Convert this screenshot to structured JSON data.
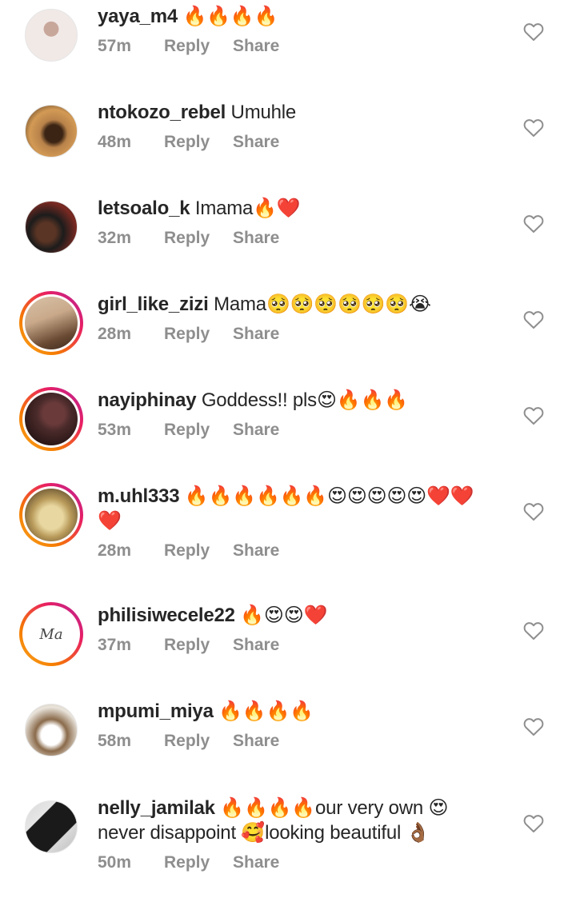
{
  "comments": [
    {
      "username": "yaya_m4",
      "text": " 🔥🔥🔥🔥",
      "time": "57m",
      "reply": "Reply",
      "share": "Share",
      "story_ring": false,
      "avatar_colors": [
        "#f1e9e6",
        "#c8a79b"
      ]
    },
    {
      "username": "ntokozo_rebel",
      "text": " Umuhle",
      "time": "48m",
      "reply": "Reply",
      "share": "Share",
      "story_ring": false,
      "avatar_colors": [
        "#d39a55",
        "#3b2414"
      ]
    },
    {
      "username": "letsoalo_k",
      "text": " Imama🔥❤️",
      "time": "32m",
      "reply": "Reply",
      "share": "Share",
      "story_ring": false,
      "avatar_colors": [
        "#7a2a22",
        "#1c1c1c"
      ]
    },
    {
      "username": "girl_like_zizi",
      "text": " Mama🥺🥺🥺🥺🥺🥺😭",
      "time": "28m",
      "reply": "Reply",
      "share": "Share",
      "story_ring": true,
      "avatar_colors": [
        "#c9a98a",
        "#6a4a33"
      ]
    },
    {
      "username": "nayiphinay",
      "text": " Goddess!! pls😍🔥🔥🔥",
      "time": "53m",
      "reply": "Reply",
      "share": "Share",
      "story_ring": true,
      "avatar_colors": [
        "#4a2a2a",
        "#140808"
      ]
    },
    {
      "username": "m.uhl333",
      "text": " 🔥🔥🔥🔥🔥🔥😍😍😍😍😍❤️❤️❤️",
      "time": "28m",
      "reply": "Reply",
      "share": "Share",
      "story_ring": true,
      "avatar_colors": [
        "#e8d7a0",
        "#7a5a2a"
      ]
    },
    {
      "username": "philisiwecele22",
      "text": " 🔥😍😍❤️",
      "time": "37m",
      "reply": "Reply",
      "share": "Share",
      "story_ring": true,
      "avatar_logo": "Ma",
      "avatar_colors": [
        "#ffffff",
        "#ffffff"
      ]
    },
    {
      "username": "mpumi_miya",
      "text": " 🔥🔥🔥🔥",
      "time": "58m",
      "reply": "Reply",
      "share": "Share",
      "story_ring": false,
      "avatar_colors": [
        "#e9e4dc",
        "#8a6a4a"
      ]
    },
    {
      "username": "nelly_jamilak",
      "text": " 🔥🔥🔥🔥our very own 😍 never disappoint 🥰looking beautiful 👌🏾",
      "time": "50m",
      "reply": "Reply",
      "share": "Share",
      "story_ring": false,
      "avatar_colors": [
        "#d9d9d9",
        "#1a1a1a"
      ]
    }
  ],
  "icons": {
    "like": "heart-outline-icon"
  },
  "colors": {
    "username": "#262626",
    "meta": "#8e8e8e",
    "heart_stroke": "#8e8e8e",
    "story_ring_start": "#f9a825",
    "story_ring_end": "#b0279b"
  }
}
